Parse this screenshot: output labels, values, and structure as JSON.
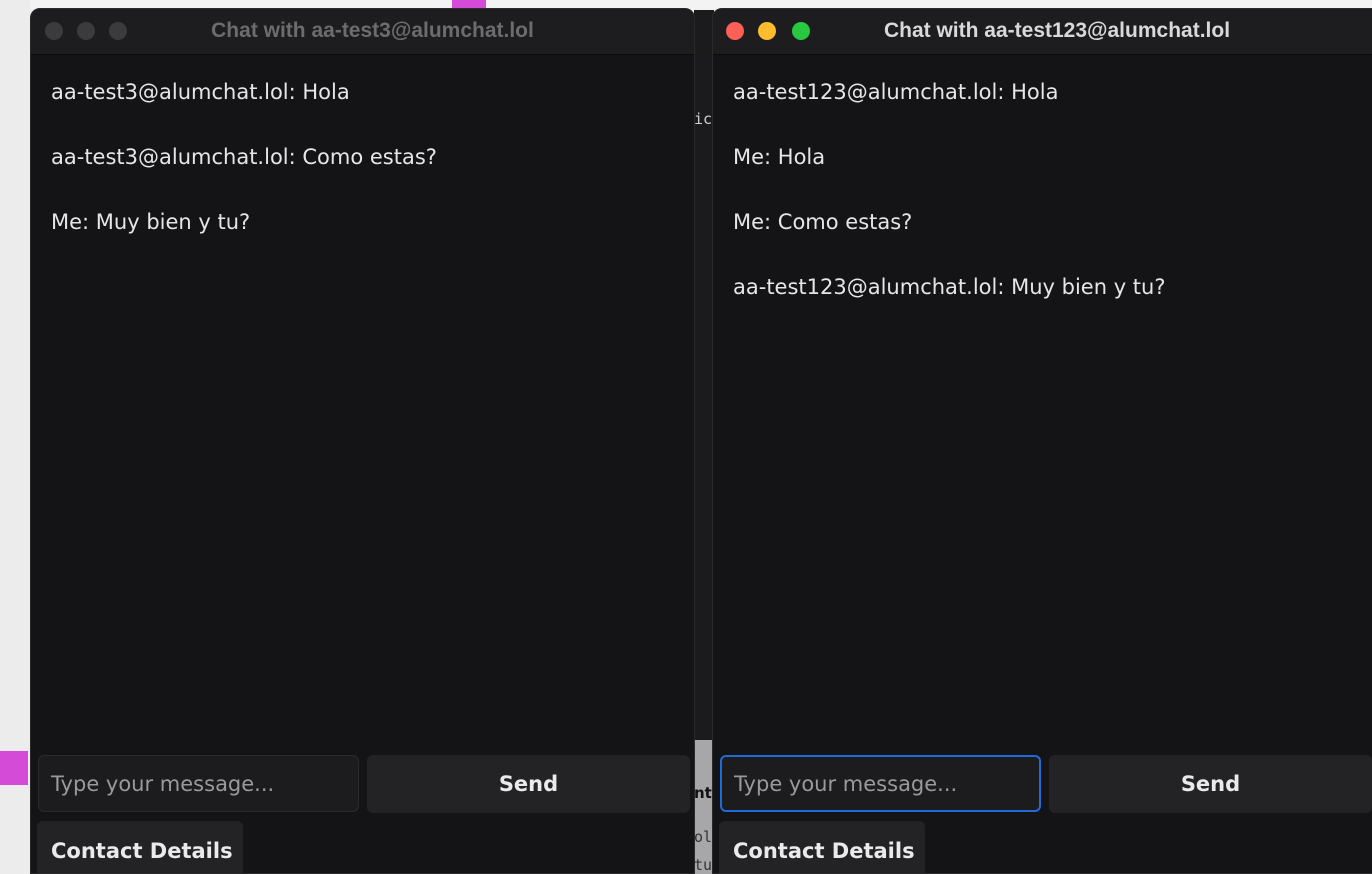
{
  "left_window": {
    "title": "Chat with aa-test3@alumchat.lol",
    "messages": [
      "aa-test3@alumchat.lol: Hola",
      "aa-test3@alumchat.lol: Como estas?",
      "Me: Muy bien y tu?"
    ],
    "input_placeholder": "Type your message...",
    "send_label": "Send",
    "contact_label": "Contact Details"
  },
  "right_window": {
    "title": "Chat with aa-test123@alumchat.lol",
    "messages": [
      "aa-test123@alumchat.lol: Hola",
      "Me: Hola",
      "Me: Como estas?",
      "aa-test123@alumchat.lol: Muy bien y tu?"
    ],
    "input_placeholder": "Type your message...",
    "send_label": "Send",
    "contact_label": "Contact Details"
  },
  "background_fragments": [
    "ic",
    "nt",
    "ol",
    "tu"
  ],
  "colors": {
    "close": "#fe5f57",
    "minimize": "#febc2e",
    "zoom": "#28c840",
    "inactive_dot": "#3b3b3d",
    "accent": "#d44bd8",
    "focus_ring": "#1f6bd8"
  }
}
